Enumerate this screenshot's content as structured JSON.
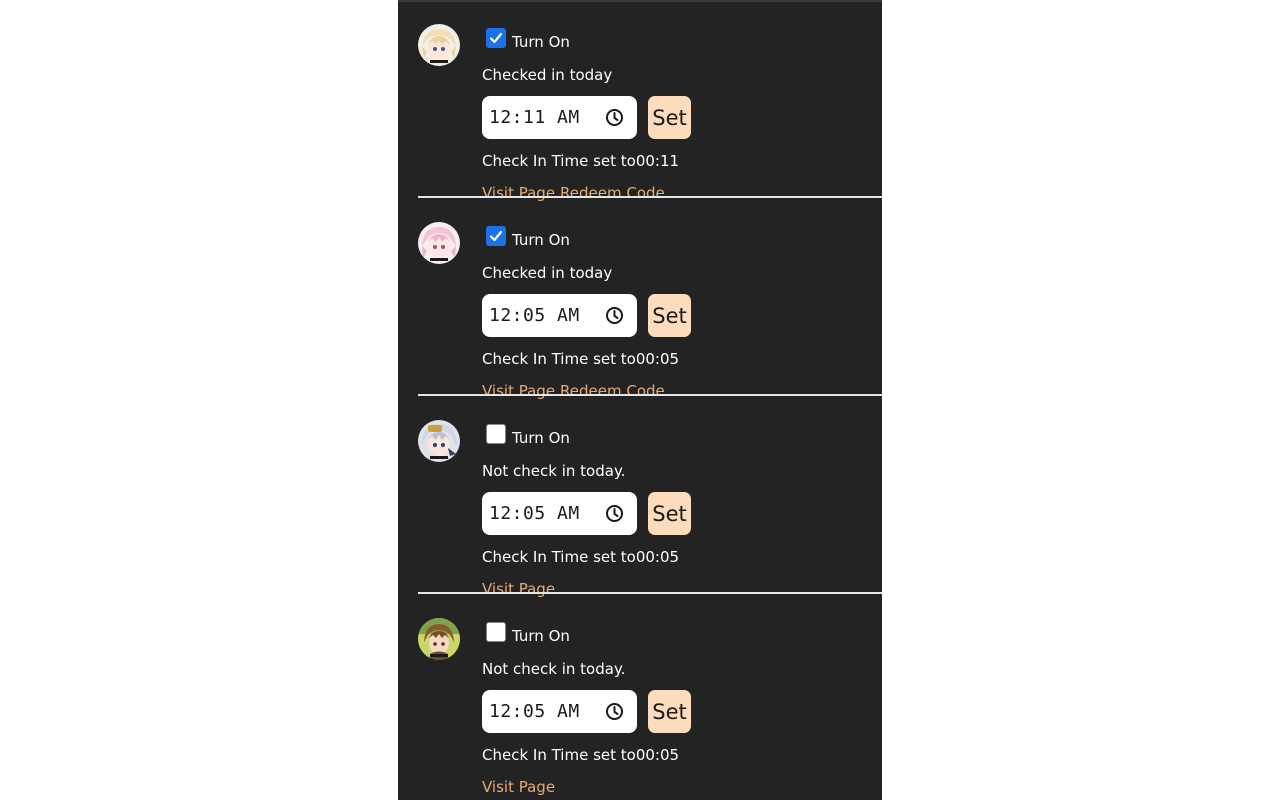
{
  "accent_colors": {
    "panel_bg": "#232323",
    "checkbox_checked": "#1a73e8",
    "set_button_bg": "#fcdcbd",
    "link_color": "#e8ab71"
  },
  "accounts": [
    {
      "avatar_icon": "character-avatar-icon",
      "turn_on_label": "Turn On",
      "turn_on_checked": true,
      "status": "Checked in today",
      "time_value": "12:11  AM",
      "set_label": "Set",
      "time_set_text": "Check In Time set to00:11",
      "visit_label": "Visit Page",
      "redeem_label": "Redeem Code"
    },
    {
      "avatar_icon": "character-avatar-icon",
      "turn_on_label": "Turn On",
      "turn_on_checked": true,
      "status": "Checked in today",
      "time_value": "12:05  AM",
      "set_label": "Set",
      "time_set_text": "Check In Time set to00:05",
      "visit_label": "Visit Page",
      "redeem_label": "Redeem Code"
    },
    {
      "avatar_icon": "character-avatar-icon",
      "turn_on_label": "Turn On",
      "turn_on_checked": false,
      "status": "Not check in today.",
      "time_value": "12:05  AM",
      "set_label": "Set",
      "time_set_text": "Check In Time set to00:05",
      "visit_label": "Visit Page",
      "redeem_label": ""
    },
    {
      "avatar_icon": "character-avatar-icon",
      "turn_on_label": "Turn On",
      "turn_on_checked": false,
      "status": "Not check in today.",
      "time_value": "12:05  AM",
      "set_label": "Set",
      "time_set_text": "Check In Time set to00:05",
      "visit_label": "Visit Page",
      "redeem_label": ""
    }
  ]
}
